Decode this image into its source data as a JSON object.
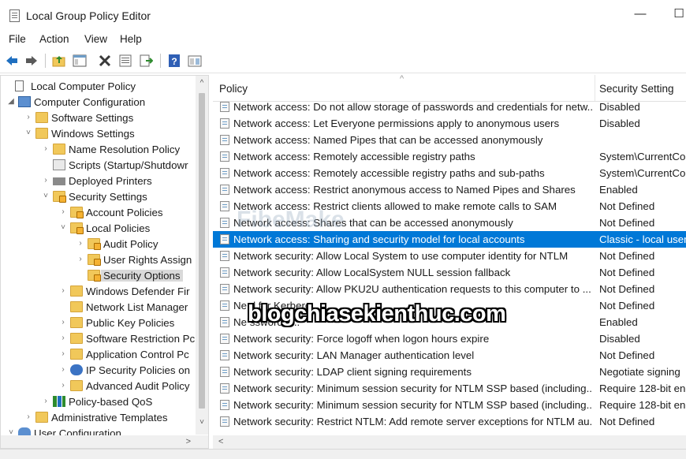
{
  "window": {
    "title": "Local Group Policy Editor",
    "minimize": "—",
    "maximize": "☐"
  },
  "menu": [
    "File",
    "Action",
    "View",
    "Help"
  ],
  "toolbar_icons": [
    "back-icon",
    "forward-icon",
    "up-folder-icon",
    "show-hide-tree-icon",
    "delete-icon",
    "properties-icon",
    "export-list-icon",
    "help-icon",
    "extended-view-icon"
  ],
  "tree": {
    "items": [
      {
        "label": "Local Computer Policy",
        "icon": "policy-icon",
        "expander": ""
      },
      {
        "label": "Computer Configuration",
        "icon": "computer-icon",
        "expander": "◢"
      },
      {
        "label": "Software Settings",
        "icon": "folder-icon",
        "expander": "›"
      },
      {
        "label": "Windows Settings",
        "icon": "folder-icon",
        "expander": "˅"
      },
      {
        "label": "Name Resolution Policy",
        "icon": "folder-icon",
        "expander": "›"
      },
      {
        "label": "Scripts (Startup/Shutdowr",
        "icon": "scripts-icon",
        "expander": ""
      },
      {
        "label": "Deployed Printers",
        "icon": "printer-icon",
        "expander": "›"
      },
      {
        "label": "Security Settings",
        "icon": "security-icon",
        "expander": "˅"
      },
      {
        "label": "Account Policies",
        "icon": "locked-folder-icon",
        "expander": "›"
      },
      {
        "label": "Local Policies",
        "icon": "locked-folder-icon",
        "expander": "˅"
      },
      {
        "label": "Audit Policy",
        "icon": "locked-folder-icon",
        "expander": "›"
      },
      {
        "label": "User Rights Assign",
        "icon": "locked-folder-icon",
        "expander": "›"
      },
      {
        "label": "Security Options",
        "icon": "locked-folder-icon",
        "expander": ""
      },
      {
        "label": "Windows Defender Fir",
        "icon": "folder-icon",
        "expander": "›"
      },
      {
        "label": "Network List Manager",
        "icon": "folder-icon",
        "expander": ""
      },
      {
        "label": "Public Key Policies",
        "icon": "folder-icon",
        "expander": "›"
      },
      {
        "label": "Software Restriction Pc",
        "icon": "folder-icon",
        "expander": "›"
      },
      {
        "label": "Application Control Pc",
        "icon": "folder-icon",
        "expander": "›"
      },
      {
        "label": "IP Security Policies on",
        "icon": "ip-security-icon",
        "expander": "›"
      },
      {
        "label": "Advanced Audit Policy",
        "icon": "folder-icon",
        "expander": "›"
      },
      {
        "label": "Policy-based QoS",
        "icon": "chart-bars-icon",
        "expander": "›"
      },
      {
        "label": "Administrative Templates",
        "icon": "folder-icon",
        "expander": "›"
      },
      {
        "label": "User Configuration",
        "icon": "user-icon",
        "expander": "˅"
      }
    ],
    "selected_index": 12
  },
  "list": {
    "headers": {
      "policy": "Policy",
      "setting": "Security Setting"
    },
    "rows": [
      {
        "policy": "Network access: Do not allow storage of passwords and credentials for netw...",
        "setting": "Disabled"
      },
      {
        "policy": "Network access: Let Everyone permissions apply to anonymous users",
        "setting": "Disabled"
      },
      {
        "policy": "Network access: Named Pipes that can be accessed anonymously",
        "setting": ""
      },
      {
        "policy": "Network access: Remotely accessible registry paths",
        "setting": "System\\CurrentCo"
      },
      {
        "policy": "Network access: Remotely accessible registry paths and sub-paths",
        "setting": "System\\CurrentCo"
      },
      {
        "policy": "Network access: Restrict anonymous access to Named Pipes and Shares",
        "setting": "Enabled"
      },
      {
        "policy": "Network access: Restrict clients allowed to make remote calls to SAM",
        "setting": "Not Defined"
      },
      {
        "policy": "Network access: Shares that can be accessed anonymously",
        "setting": "Not Defined"
      },
      {
        "policy": "Network access: Sharing and security model for local accounts",
        "setting": "Classic - local users"
      },
      {
        "policy": "Network security: Allow Local System to use computer identity for NTLM",
        "setting": "Not Defined"
      },
      {
        "policy": "Network security: Allow LocalSystem NULL session fallback",
        "setting": "Not Defined"
      },
      {
        "policy": "Network security: Allow PKU2U authentication requests to this computer to ...",
        "setting": "Not Defined"
      },
      {
        "policy": "Ne                                                           d for Kerbero",
        "setting": "Not Defined"
      },
      {
        "policy": "Ne                                                          ssword c...",
        "setting": "Enabled"
      },
      {
        "policy": "Network security: Force logoff when logon hours expire",
        "setting": "Disabled"
      },
      {
        "policy": "Network security: LAN Manager authentication level",
        "setting": "Not Defined"
      },
      {
        "policy": "Network security: LDAP client signing requirements",
        "setting": "Negotiate signing"
      },
      {
        "policy": "Network security: Minimum session security for NTLM SSP based (including...",
        "setting": "Require 128-bit enc"
      },
      {
        "policy": "Network security: Minimum session security for NTLM SSP based (including...",
        "setting": "Require 128-bit enc"
      },
      {
        "policy": "Network security: Restrict NTLM: Add remote server exceptions for NTLM au...",
        "setting": "Not Defined"
      }
    ],
    "selected_index": 8,
    "sort_indicator": "^",
    "selection_color": "#0078d7"
  },
  "scroll": {
    "up": "^",
    "down": "˅",
    "left": "<",
    "right": ">"
  },
  "watermarks": {
    "main": "blogchiasekienthuc.com",
    "faint": "FibeMake"
  }
}
